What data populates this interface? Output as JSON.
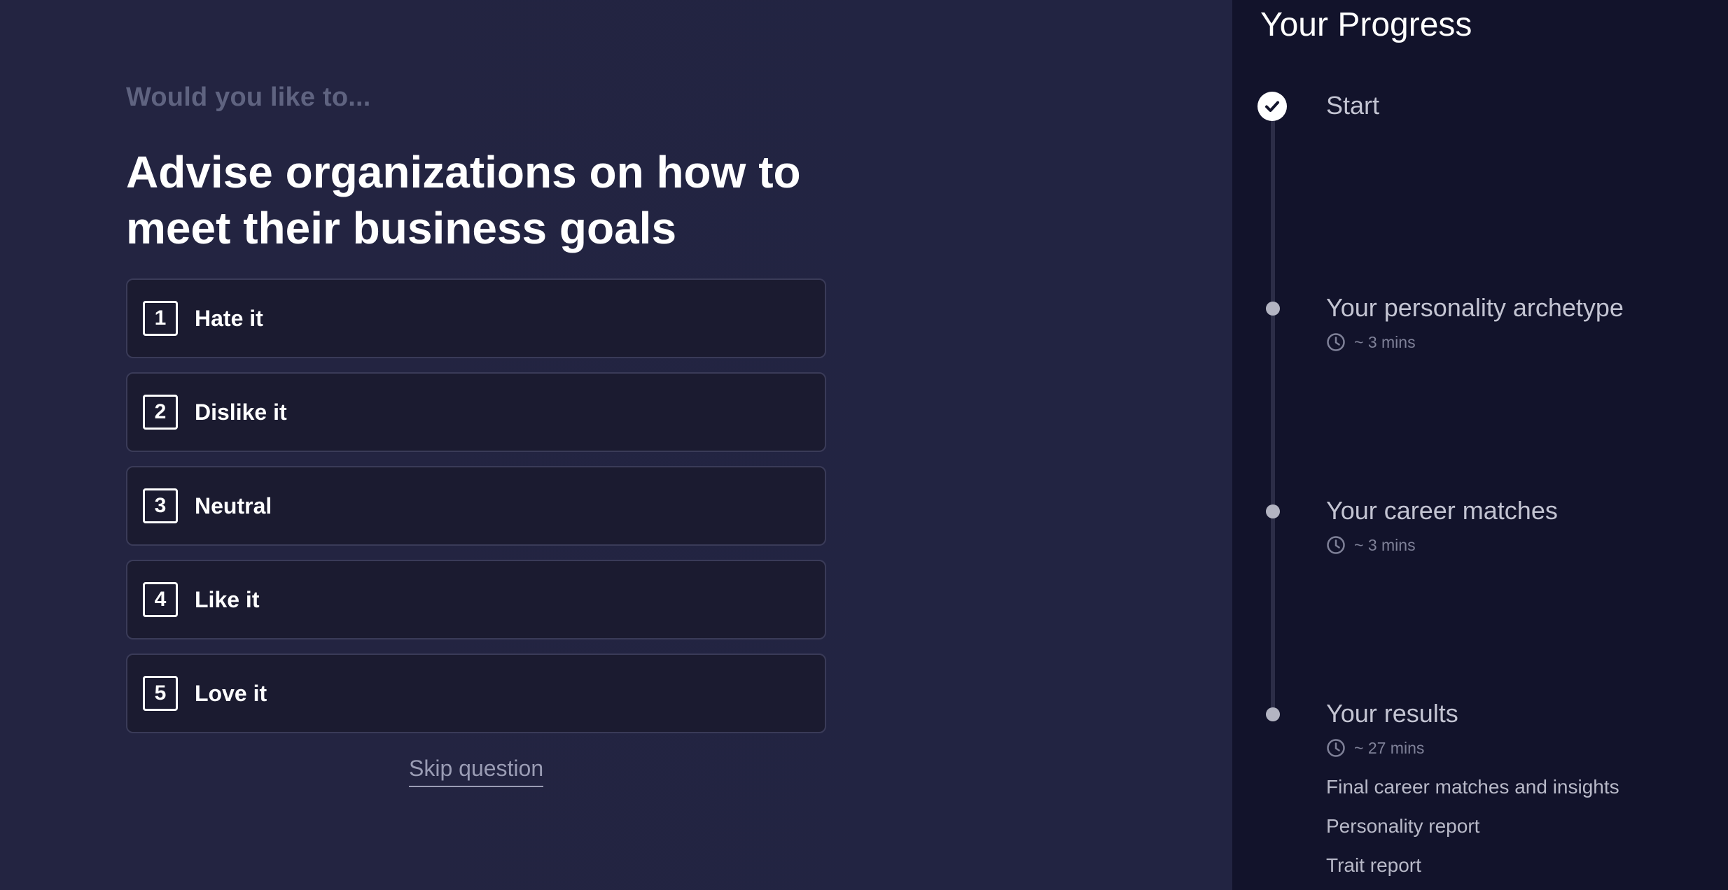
{
  "question": {
    "prompt": "Would you like to...",
    "text": "Advise organizations on how to meet their business goals"
  },
  "options": [
    {
      "key": "1",
      "label": "Hate it"
    },
    {
      "key": "2",
      "label": "Dislike it"
    },
    {
      "key": "3",
      "label": "Neutral"
    },
    {
      "key": "4",
      "label": "Like it"
    },
    {
      "key": "5",
      "label": "Love it"
    }
  ],
  "skip_label": "Skip question",
  "progress": {
    "title": "Your Progress",
    "steps": [
      {
        "title": "Start",
        "status": "complete"
      },
      {
        "title": "Your personality archetype",
        "time": "~ 3 mins",
        "status": "pending"
      },
      {
        "title": "Your career matches",
        "time": "~ 3 mins",
        "status": "pending"
      },
      {
        "title": "Your results",
        "time": "~ 27 mins",
        "status": "pending",
        "items": [
          "Final career matches and insights",
          "Personality report",
          "Trait report"
        ]
      }
    ]
  },
  "colors": {
    "background": "#222441",
    "panel": "#12132b",
    "option_bg": "#1b1b30",
    "option_border": "#3a3b58"
  }
}
